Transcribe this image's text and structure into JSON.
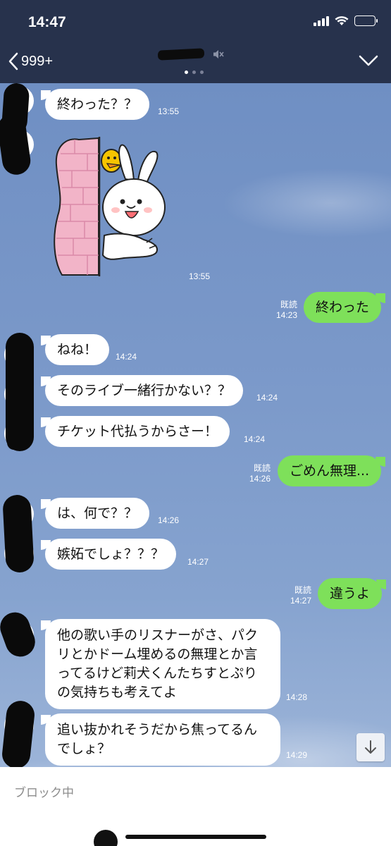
{
  "status_bar": {
    "time": "14:47"
  },
  "header": {
    "back_count": "999+"
  },
  "messages": [
    {
      "text": "終わった？？",
      "time": "13:55"
    },
    {
      "time": "13:55"
    },
    {
      "text": "終わった",
      "read": "既読",
      "time": "14:23"
    },
    {
      "text": "ねね！",
      "time": "14:24"
    },
    {
      "text": "そのライブ一緒行かない？？",
      "time": "14:24"
    },
    {
      "text": "チケット代払うからさー！",
      "time": "14:24"
    },
    {
      "text": "ごめん無理...",
      "read": "既読",
      "time": "14:26"
    },
    {
      "text": "は、何で？？",
      "time": "14:26"
    },
    {
      "text": "嫉妬でしょ？？？",
      "time": "14:27"
    },
    {
      "text": "違うよ",
      "read": "既読",
      "time": "14:27"
    },
    {
      "lines": [
        "他の歌い手のリスナーがさ、パク",
        "リとかドーム埋めるの無理とか言",
        "ってるけど莉犬くんたちすとぷり",
        "の気持ちも考えてよ"
      ],
      "time": "14:28"
    },
    {
      "lines": [
        "追い抜かれそうだから焦ってるん",
        "でしょ？"
      ],
      "time": "14:29"
    }
  ],
  "footer": {
    "status": "ブロック中"
  },
  "colors": {
    "header": "#27324c",
    "outgoing_bubble": "#7ee05a",
    "incoming_bubble": "#ffffff"
  }
}
